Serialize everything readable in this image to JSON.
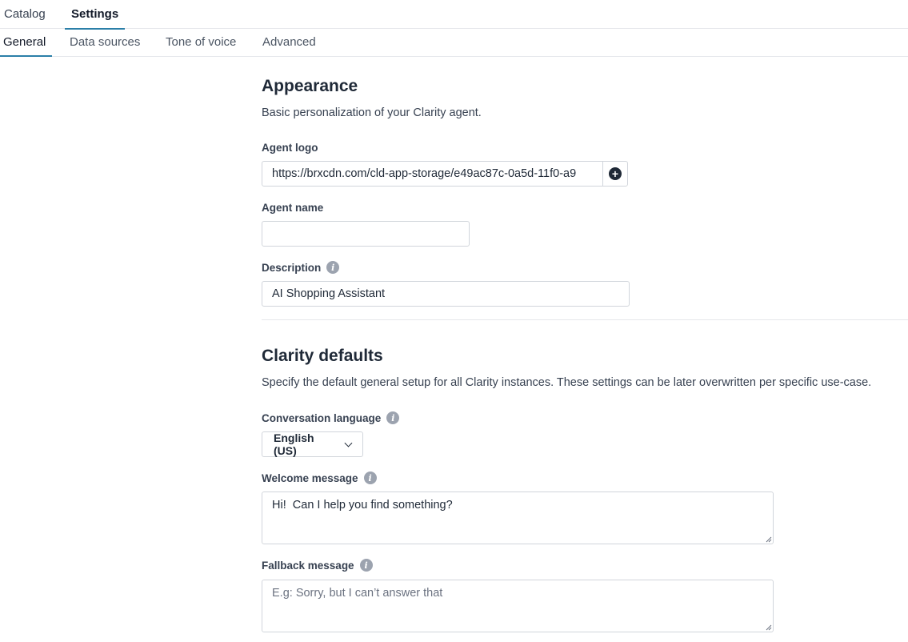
{
  "top_tabs": [
    {
      "label": "Catalog",
      "active": false
    },
    {
      "label": "Settings",
      "active": true
    }
  ],
  "sub_tabs": [
    {
      "label": "General",
      "active": true
    },
    {
      "label": "Data sources",
      "active": false
    },
    {
      "label": "Tone of voice",
      "active": false
    },
    {
      "label": "Advanced",
      "active": false
    }
  ],
  "appearance": {
    "title": "Appearance",
    "description": "Basic personalization of your Clarity agent.",
    "agent_logo": {
      "label": "Agent logo",
      "value": "https://brxcdn.com/cld-app-storage/e49ac87c-0a5d-11f0-a9",
      "addon_icon": "plus-circle-icon"
    },
    "agent_name": {
      "label": "Agent name",
      "value": ""
    },
    "description_field": {
      "label": "Description",
      "value": "AI Shopping Assistant"
    }
  },
  "defaults": {
    "title": "Clarity defaults",
    "description": "Specify the default general setup for all Clarity instances. These settings can be later overwritten per specific use-case.",
    "conversation_language": {
      "label": "Conversation language",
      "selected": "English (US)"
    },
    "welcome_message": {
      "label": "Welcome message",
      "value": "Hi!  Can I help you find something?"
    },
    "fallback_message": {
      "label": "Fallback message",
      "placeholder": "E.g: Sorry, but I can’t answer that"
    }
  },
  "colors": {
    "accent": "#2b7fa8",
    "border": "#d1d5db",
    "text": "#1f2937",
    "info_icon": "#9ca3af"
  }
}
